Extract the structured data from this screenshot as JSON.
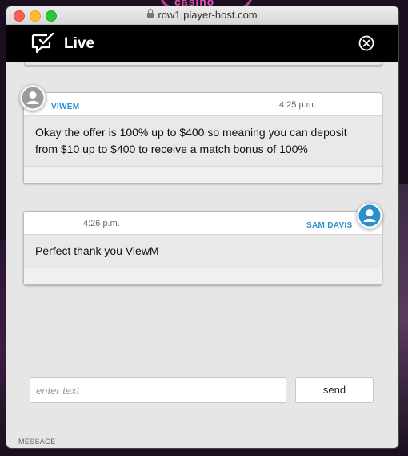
{
  "browser": {
    "url": "row1.player-host.com"
  },
  "background": {
    "sign_text": "casino"
  },
  "header": {
    "title": "Live"
  },
  "messages": [
    {
      "sender": "VIWEM",
      "time": "4:25 p.m.",
      "text": "Okay the offer is 100% up to $400 so meaning you can deposit from $10 up to $400 to receive a match bonus of 100%",
      "avatar": "gray-user-avatar"
    },
    {
      "sender": "SAM DAVIS",
      "time": "4:26 p.m.",
      "text": "Perfect thank you ViewM",
      "avatar": "blue-user-avatar"
    }
  ],
  "composer": {
    "placeholder": "enter text",
    "send_label": "send",
    "section_label": "MESSAGE"
  },
  "colors": {
    "accent": "#2a8fce",
    "header_bg": "#000000",
    "window_bg": "#e6e6e6"
  }
}
